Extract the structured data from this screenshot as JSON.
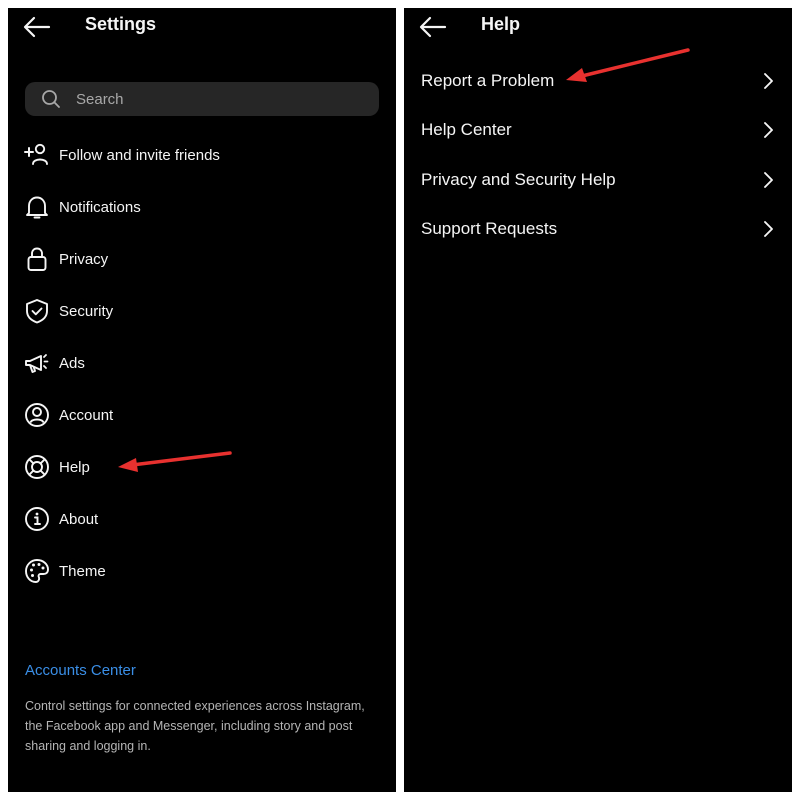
{
  "settings_screen": {
    "title": "Settings",
    "back_icon": "arrow-left-icon",
    "search": {
      "placeholder": "Search",
      "icon": "search-icon"
    },
    "items": [
      {
        "label": "Follow and invite friends",
        "icon": "add-person-icon"
      },
      {
        "label": "Notifications",
        "icon": "bell-icon"
      },
      {
        "label": "Privacy",
        "icon": "lock-icon"
      },
      {
        "label": "Security",
        "icon": "shield-check-icon"
      },
      {
        "label": "Ads",
        "icon": "megaphone-icon"
      },
      {
        "label": "Account",
        "icon": "user-circle-icon"
      },
      {
        "label": "Help",
        "icon": "lifebuoy-icon"
      },
      {
        "label": "About",
        "icon": "info-icon"
      },
      {
        "label": "Theme",
        "icon": "palette-icon"
      }
    ],
    "accounts_center": {
      "link": "Accounts Center",
      "description": "Control settings for connected experiences across Instagram, the Facebook app and Messenger, including story and post sharing and logging in."
    },
    "annotation": {
      "points_to": "Help",
      "color": "#e8312f"
    }
  },
  "help_screen": {
    "title": "Help",
    "back_icon": "arrow-left-icon",
    "items": [
      {
        "label": "Report a Problem",
        "icon": "chevron-right-icon"
      },
      {
        "label": "Help Center",
        "icon": "chevron-right-icon"
      },
      {
        "label": "Privacy and Security Help",
        "icon": "chevron-right-icon"
      },
      {
        "label": "Support Requests",
        "icon": "chevron-right-icon"
      }
    ],
    "annotation": {
      "points_to": "Report a Problem",
      "color": "#e8312f"
    }
  },
  "colors": {
    "background": "#000000",
    "text": "#f5f5f5",
    "search_bg": "#262626",
    "link": "#3a8ee6",
    "annotation": "#e8312f"
  }
}
